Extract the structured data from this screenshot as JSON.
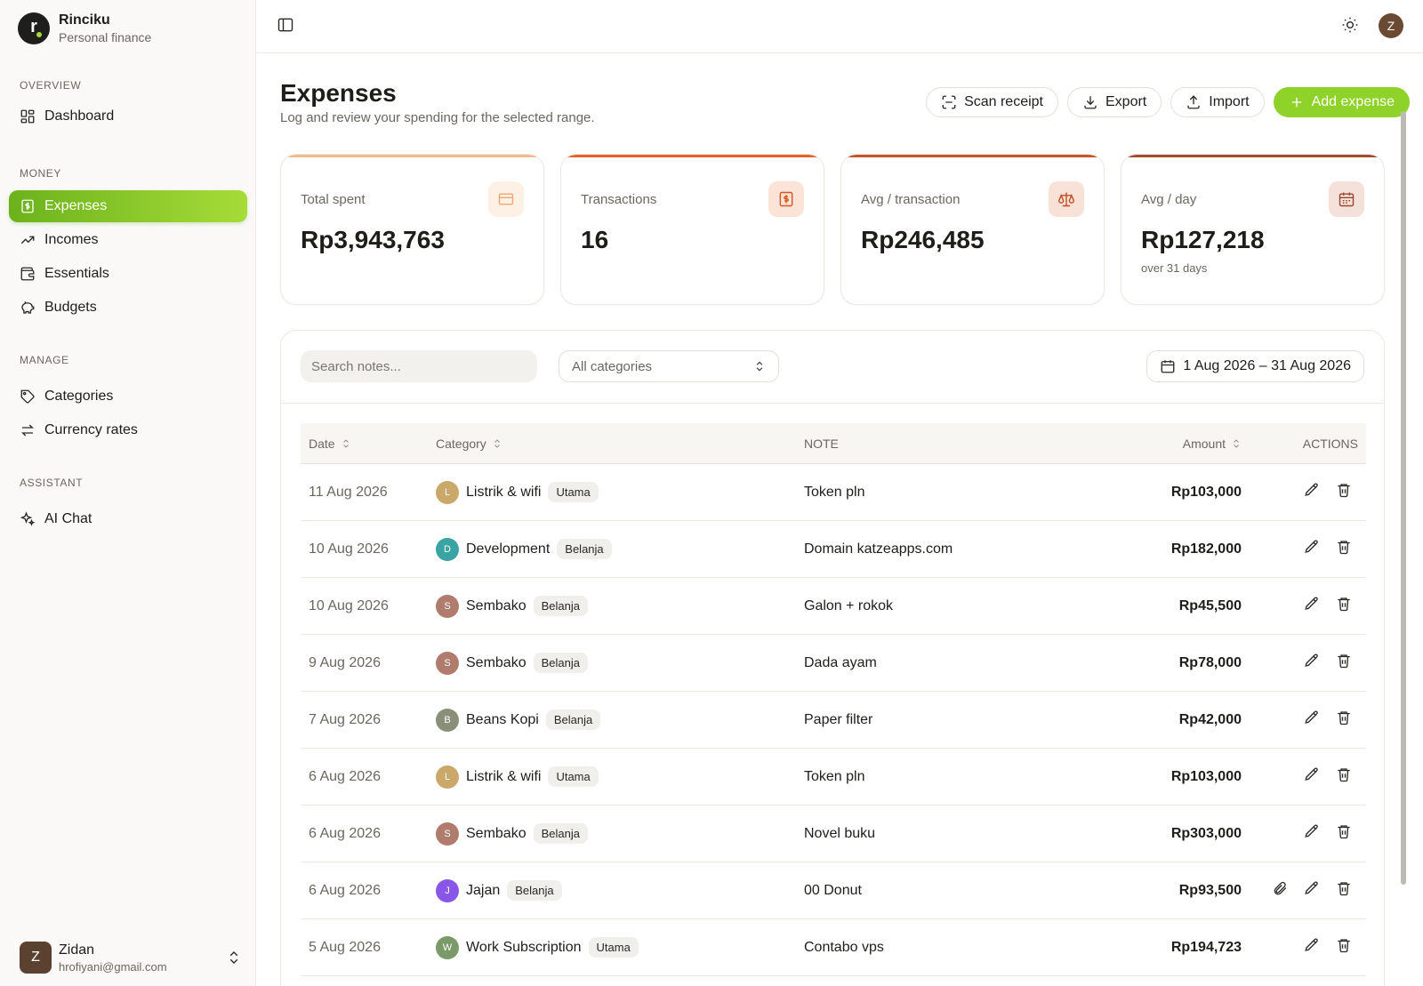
{
  "brand": {
    "name": "Rinciku",
    "subtitle": "Personal finance"
  },
  "sidebar": {
    "sections": [
      {
        "label": "OVERVIEW",
        "items": [
          {
            "label": "Dashboard",
            "icon": "dashboard-icon"
          }
        ]
      },
      {
        "label": "MONEY",
        "items": [
          {
            "label": "Expenses",
            "icon": "receipt-icon",
            "active": true
          },
          {
            "label": "Incomes",
            "icon": "trending-up-icon"
          },
          {
            "label": "Essentials",
            "icon": "wallet-icon"
          },
          {
            "label": "Budgets",
            "icon": "piggy-bank-icon"
          }
        ]
      },
      {
        "label": "MANAGE",
        "items": [
          {
            "label": "Categories",
            "icon": "tag-icon"
          },
          {
            "label": "Currency rates",
            "icon": "swap-icon"
          }
        ]
      },
      {
        "label": "ASSISTANT",
        "items": [
          {
            "label": "AI Chat",
            "icon": "sparkles-icon"
          }
        ]
      }
    ],
    "user": {
      "initial": "Z",
      "name": "Zidan",
      "email": "hrofiyani@gmail.com"
    }
  },
  "topbar": {
    "avatar_initial": "Z"
  },
  "page": {
    "title": "Expenses",
    "subtitle": "Log and review your spending for the selected range.",
    "actions": {
      "scan": "Scan receipt",
      "export": "Export",
      "import": "Import",
      "add": "Add expense"
    }
  },
  "stats": [
    {
      "label": "Total spent",
      "value": "Rp3,943,763",
      "note": "",
      "icon": "credit-card-icon",
      "accent": "#f2b98c",
      "icon_bg": "#fdf1e6",
      "icon_color": "#f0a56e"
    },
    {
      "label": "Transactions",
      "value": "16",
      "note": "",
      "icon": "dollar-receipt-icon",
      "accent": "#e8602a",
      "icon_bg": "#fbe3d7",
      "icon_color": "#d9541e"
    },
    {
      "label": "Avg / transaction",
      "value": "Rp246,485",
      "note": "",
      "icon": "scale-icon",
      "accent": "#c6522a",
      "icon_bg": "#f8e1d6",
      "icon_color": "#c24f26"
    },
    {
      "label": "Avg / day",
      "value": "Rp127,218",
      "note": "over 31 days",
      "icon": "calendar-icon",
      "accent": "#a34a32",
      "icon_bg": "#f3e1da",
      "icon_color": "#9e4530"
    }
  ],
  "filters": {
    "search_placeholder": "Search notes...",
    "category_value": "All categories",
    "date_range": "1 Aug 2026 – 31 Aug 2026"
  },
  "table": {
    "headers": {
      "date": "Date",
      "category": "Category",
      "note": "NOTE",
      "amount": "Amount",
      "actions": "ACTIONS"
    },
    "rows": [
      {
        "date": "11 Aug 2026",
        "initial": "L",
        "color": "#c9a86a",
        "category": "Listrik & wifi",
        "tag": "Utama",
        "note": "Token pln",
        "amount": "Rp103,000",
        "attachment": false
      },
      {
        "date": "10 Aug 2026",
        "initial": "D",
        "color": "#3aa3a3",
        "category": "Development",
        "tag": "Belanja",
        "note": "Domain katzeapps.com",
        "amount": "Rp182,000",
        "attachment": false
      },
      {
        "date": "10 Aug 2026",
        "initial": "S",
        "color": "#b07c6e",
        "category": "Sembako",
        "tag": "Belanja",
        "note": "Galon + rokok",
        "amount": "Rp45,500",
        "attachment": false
      },
      {
        "date": "9 Aug 2026",
        "initial": "S",
        "color": "#b07c6e",
        "category": "Sembako",
        "tag": "Belanja",
        "note": "Dada ayam",
        "amount": "Rp78,000",
        "attachment": false
      },
      {
        "date": "7 Aug 2026",
        "initial": "B",
        "color": "#8a8f7a",
        "category": "Beans Kopi",
        "tag": "Belanja",
        "note": "Paper filter",
        "amount": "Rp42,000",
        "attachment": false
      },
      {
        "date": "6 Aug 2026",
        "initial": "L",
        "color": "#c9a86a",
        "category": "Listrik & wifi",
        "tag": "Utama",
        "note": "Token pln",
        "amount": "Rp103,000",
        "attachment": false
      },
      {
        "date": "6 Aug 2026",
        "initial": "S",
        "color": "#b07c6e",
        "category": "Sembako",
        "tag": "Belanja",
        "note": "Novel buku",
        "amount": "Rp303,000",
        "attachment": false
      },
      {
        "date": "6 Aug 2026",
        "initial": "J",
        "color": "#8a56e8",
        "category": "Jajan",
        "tag": "Belanja",
        "note": "00 Donut",
        "amount": "Rp93,500",
        "attachment": true
      },
      {
        "date": "5 Aug 2026",
        "initial": "W",
        "color": "#7a9a6a",
        "category": "Work Subscription",
        "tag": "Utama",
        "note": "Contabo vps",
        "amount": "Rp194,723",
        "attachment": false
      }
    ]
  }
}
